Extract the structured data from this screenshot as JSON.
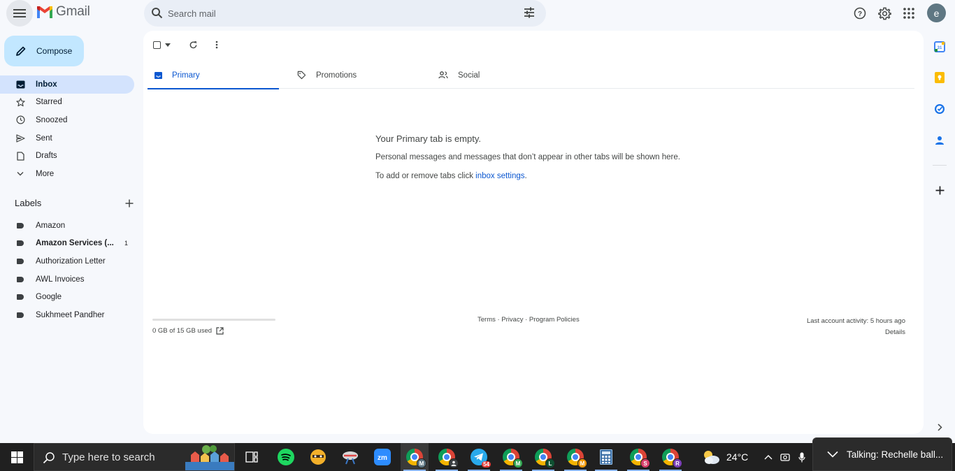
{
  "app": {
    "name": "Gmail",
    "avatar_letter": "e"
  },
  "search": {
    "placeholder": "Search mail"
  },
  "compose": {
    "label": "Compose"
  },
  "nav": [
    {
      "label": "Inbox",
      "icon": "inbox-icon",
      "active": true
    },
    {
      "label": "Starred",
      "icon": "star-icon"
    },
    {
      "label": "Snoozed",
      "icon": "clock-icon"
    },
    {
      "label": "Sent",
      "icon": "send-icon"
    },
    {
      "label": "Drafts",
      "icon": "draft-icon"
    },
    {
      "label": "More",
      "icon": "chevron-down-icon"
    }
  ],
  "labels": {
    "title": "Labels",
    "items": [
      {
        "label": "Amazon",
        "count": ""
      },
      {
        "label": "Amazon Services (...",
        "count": "1"
      },
      {
        "label": "Authorization Letter",
        "count": ""
      },
      {
        "label": "AWL Invoices",
        "count": ""
      },
      {
        "label": "Google",
        "count": ""
      },
      {
        "label": "Sukhmeet Pandher",
        "count": ""
      }
    ]
  },
  "tabs": [
    {
      "label": "Primary",
      "active": true
    },
    {
      "label": "Promotions"
    },
    {
      "label": "Social"
    }
  ],
  "empty": {
    "title": "Your Primary tab is empty.",
    "line1": "Personal messages and messages that don’t appear in other tabs will be shown here.",
    "line2_prefix": "To add or remove tabs click ",
    "line2_link": "inbox settings",
    "line2_suffix": "."
  },
  "footer": {
    "storage": "0 GB of 15 GB used",
    "storage_used_fraction": 0,
    "links": "Terms · Privacy · Program Policies",
    "activity": "Last account activity: 5 hours ago",
    "details": "Details"
  },
  "taskbar": {
    "search_placeholder": "Type here to search",
    "weather": "24°C",
    "telegram_badge": "54",
    "talking": "Talking: Rechelle ball...",
    "chrome_badges": [
      "M",
      "",
      "M",
      "L",
      "M",
      "S",
      "R"
    ]
  },
  "colors": {
    "accent": "#0b57d0",
    "compose_bg": "#c2e7ff",
    "active_nav_bg": "#d3e3fd",
    "page_bg": "#f6f8fc",
    "taskbar_bg": "#202020"
  }
}
